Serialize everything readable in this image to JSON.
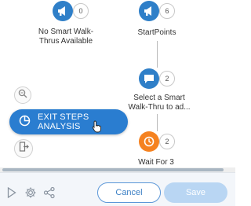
{
  "steps": [
    {
      "label": "No Smart Walk-\nThrus Available",
      "count": "0",
      "icon": "megaphone-icon",
      "color": "#2f7fc8"
    },
    {
      "label": "StartPoints",
      "count": "6",
      "icon": "megaphone-icon",
      "color": "#2f7fc8"
    },
    {
      "label": "Select a Smart\nWalk-Thru to ad...",
      "count": "2",
      "icon": "message-bubble-icon",
      "color": "#2f7fc8"
    },
    {
      "label": "Wait For 3",
      "count": "2",
      "icon": "clock-icon",
      "color": "#f58220"
    }
  ],
  "tools": {
    "zoom_icon": "magnifier-icon",
    "exit_analysis_label": "EXIT STEPS ANALYSIS",
    "exit_analysis_icon": "pie-chart-icon",
    "exit_icon": "exit-door-icon"
  },
  "footer": {
    "cancel_label": "Cancel",
    "save_label": "Save",
    "icons": [
      "play-icon",
      "gear-icon",
      "share-icon"
    ]
  },
  "colors": {
    "accent": "#2a7dd0",
    "step_orange": "#f58220",
    "save_disabled": "#b9d6f3"
  }
}
